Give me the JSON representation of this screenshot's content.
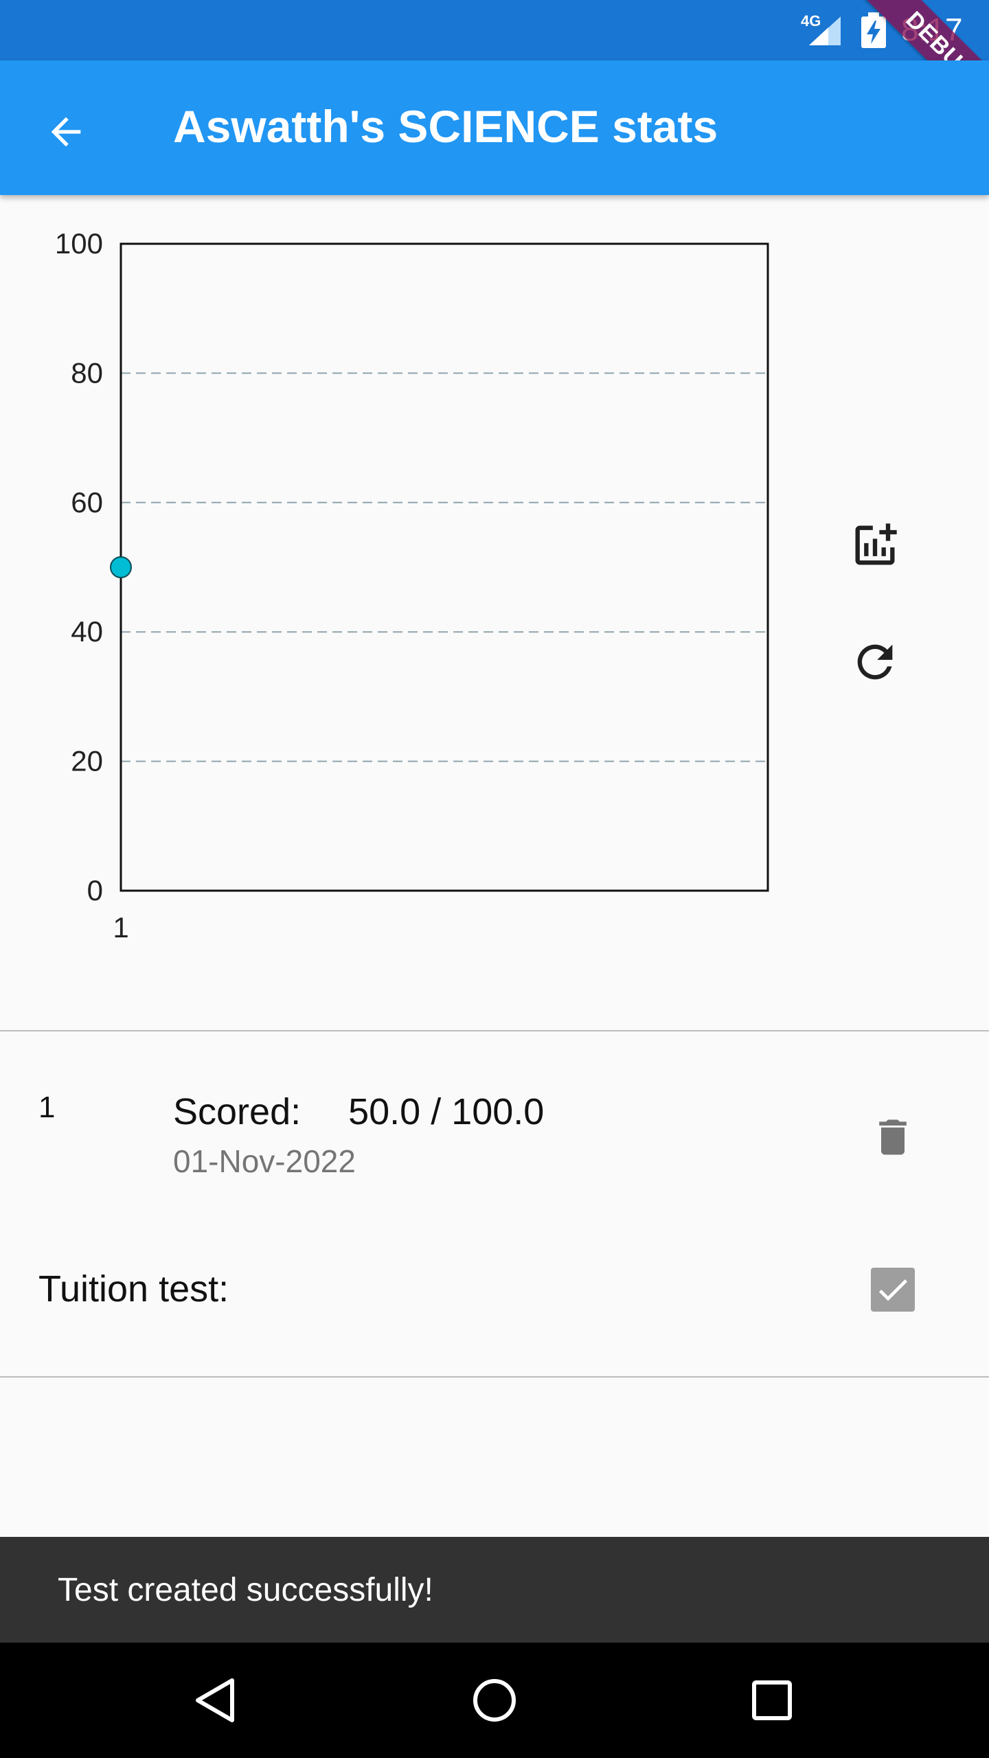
{
  "status_bar": {
    "network": "4G",
    "time": "8:17"
  },
  "debug_banner": "DEBUG",
  "app_bar": {
    "title": "Aswatth's SCIENCE stats",
    "back_icon": "arrow-back-icon"
  },
  "chart_data": {
    "type": "scatter",
    "x": [
      1
    ],
    "y": [
      50
    ],
    "x_ticks": [
      "1"
    ],
    "y_ticks": [
      "0",
      "20",
      "40",
      "60",
      "80",
      "100"
    ],
    "ylim": [
      0,
      100
    ],
    "grid": "horizontal-dashed",
    "point_color": "#00bcd4"
  },
  "side_actions": {
    "add_chart_icon": "add-chart-icon",
    "refresh_icon": "refresh-icon"
  },
  "test_list": {
    "items": [
      {
        "index": "1",
        "score": "Scored:  50.0 / 100.0",
        "date": "01-Nov-2022",
        "delete_icon": "trash-icon",
        "tuition_label": "Tuition test:",
        "tuition_checked": true
      }
    ]
  },
  "snackbar": {
    "message": "Test created successfully!"
  },
  "colors": {
    "status_bar": "#1976d2",
    "app_bar": "#2196f3",
    "snackbar": "#323232",
    "data_point": "#00bcd4"
  }
}
